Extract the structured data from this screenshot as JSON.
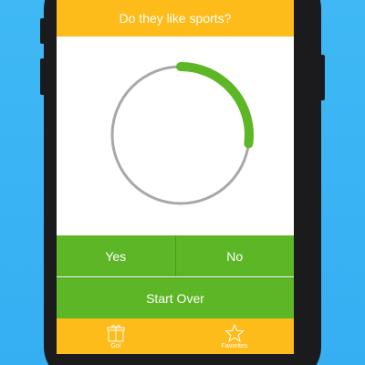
{
  "header": {
    "title": "Do they like sports?"
  },
  "progress": {
    "fraction": 0.27,
    "track_color": "#a8a8a8",
    "fill_color": "#5cb625"
  },
  "answers": {
    "yes_label": "Yes",
    "no_label": "No"
  },
  "actions": {
    "start_over_label": "Start Over"
  },
  "tabbar": {
    "items": [
      {
        "label": "Go!",
        "icon": "gift-icon"
      },
      {
        "label": "Favorites",
        "icon": "star-icon"
      }
    ]
  },
  "colors": {
    "accent_yellow": "#fdbc19",
    "accent_green": "#5cb625",
    "background_blue": "#3fb8f5"
  }
}
